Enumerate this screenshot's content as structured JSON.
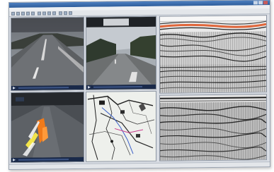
{
  "window": {
    "title": "",
    "menu": []
  },
  "panels": {
    "camera_front": {
      "icon": "play-icon"
    },
    "camera_road": {
      "icon": "play-icon"
    },
    "camera_lidar": {
      "icon": "play-icon"
    },
    "map": {
      "icon": "map-icon"
    },
    "radar_top": {
      "accent": "#e0663a"
    },
    "radar_bottom": {}
  },
  "colors": {
    "titlebar": "#2f5e9c",
    "window_bg": "#d9dde4",
    "radar_highlight": "#e0663a",
    "lidar_orange": "#f07a1a"
  }
}
